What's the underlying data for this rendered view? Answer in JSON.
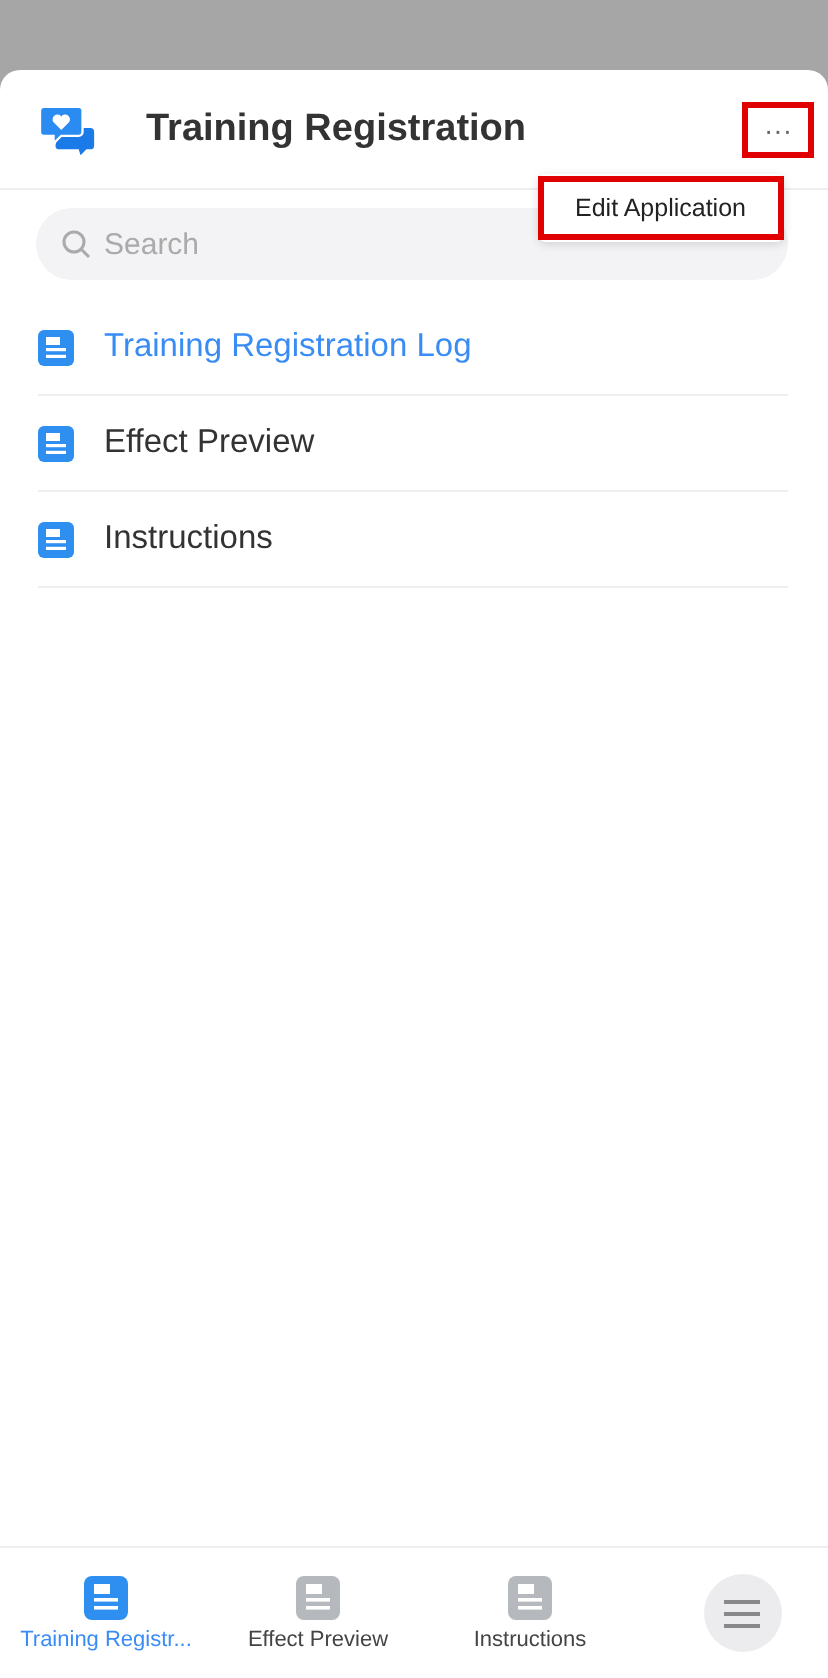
{
  "header": {
    "title": "Training Registration",
    "more_button": "···"
  },
  "menu": {
    "items": [
      "Edit Application"
    ]
  },
  "search": {
    "placeholder": "Search"
  },
  "list": [
    {
      "label": "Training Registration Log",
      "selected": true
    },
    {
      "label": "Effect Preview",
      "selected": false
    },
    {
      "label": "Instructions",
      "selected": false
    }
  ],
  "tab_bar": [
    {
      "label": "Training Registr...",
      "selected": true
    },
    {
      "label": "Effect Preview",
      "selected": false
    },
    {
      "label": "Instructions",
      "selected": false
    }
  ]
}
